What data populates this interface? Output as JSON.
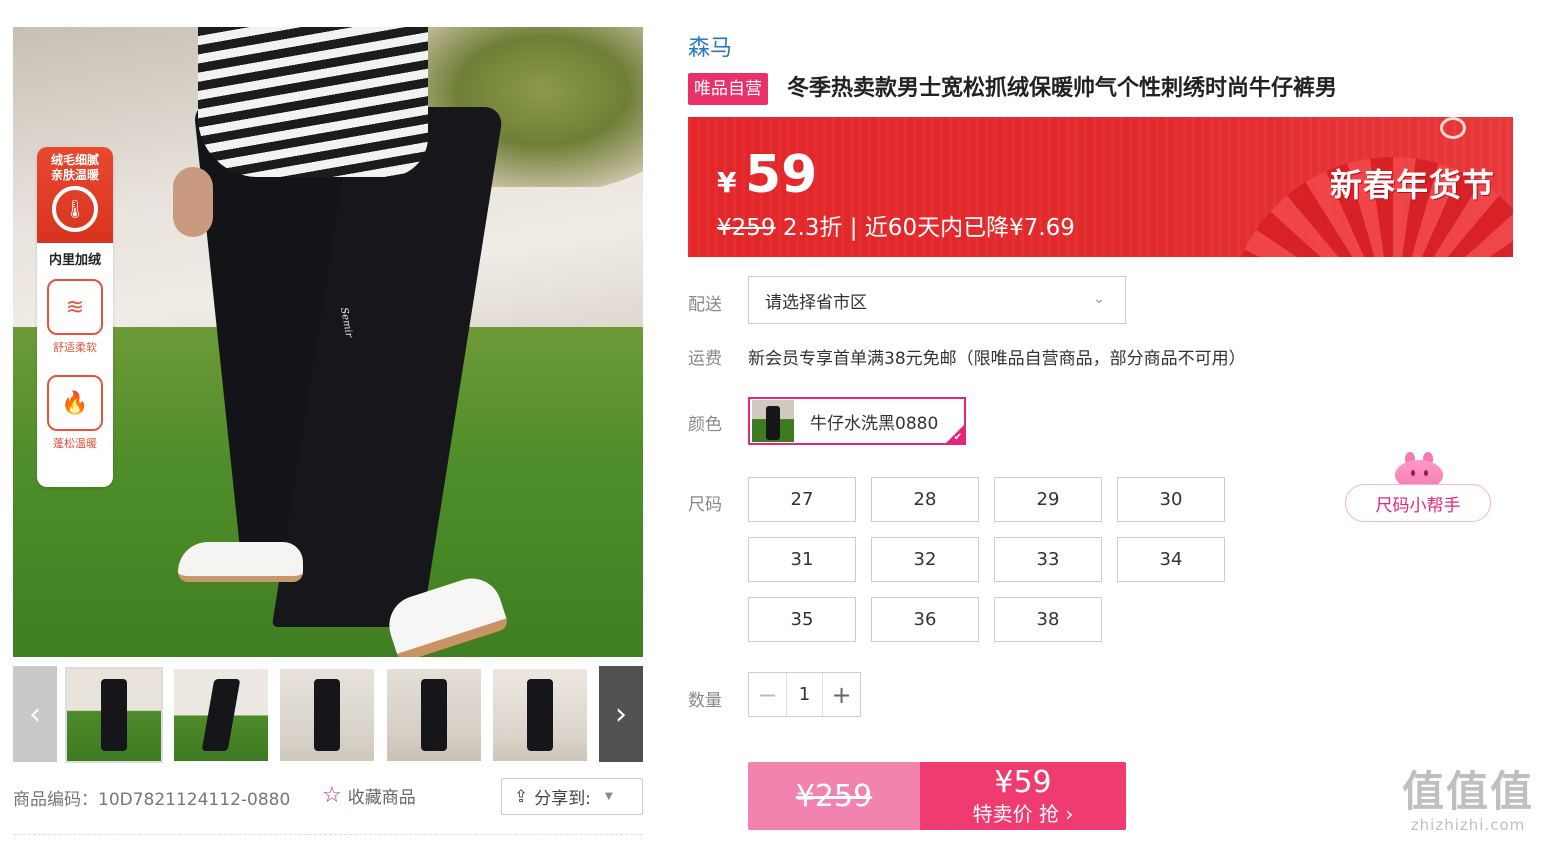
{
  "gallery": {
    "badges": {
      "top_text": "绒毛细腻\n亲肤温暖",
      "lining": "内里加绒",
      "soft": "舒适柔软",
      "warm": "蓬松温暖"
    },
    "embroidery": "Semir"
  },
  "sku_label": "商品编码：10D7821124112-0880",
  "favorite_label": "收藏商品",
  "share_label": "分享到:",
  "brand": "森马",
  "tag": "唯品自营",
  "title": "冬季热卖款男士宽松抓绒保暖帅气个性刺绣时尚牛仔裤男",
  "price": {
    "currency": "¥",
    "current": "59",
    "original": "¥259",
    "discount_text": " 2.3折 | 近60天内已降¥7.69",
    "festival": "新春年货节"
  },
  "delivery": {
    "label": "配送",
    "placeholder": "请选择省市区"
  },
  "shipping": {
    "label": "运费",
    "text": "新会员专享首单满38元免邮（限唯品自营商品，部分商品不可用）"
  },
  "color": {
    "label": "颜色",
    "selected": "牛仔水洗黑0880"
  },
  "size": {
    "label": "尺码",
    "options": [
      "27",
      "28",
      "29",
      "30",
      "31",
      "32",
      "33",
      "34",
      "35",
      "36",
      "38"
    ],
    "helper": "尺码小帮手"
  },
  "quantity": {
    "label": "数量",
    "value": "1",
    "minus": "−",
    "plus": "+"
  },
  "buy": {
    "original": "¥259",
    "price": "¥59",
    "action": "特卖价 抢 ›"
  },
  "watermark": {
    "big": "值值值",
    "small": "zhizhizhi.com"
  },
  "colors": {
    "accent": "#e3267a",
    "brand_link": "#2a78c2",
    "banner_red": "#e3262a",
    "buy_pink": "#ef3b70"
  }
}
